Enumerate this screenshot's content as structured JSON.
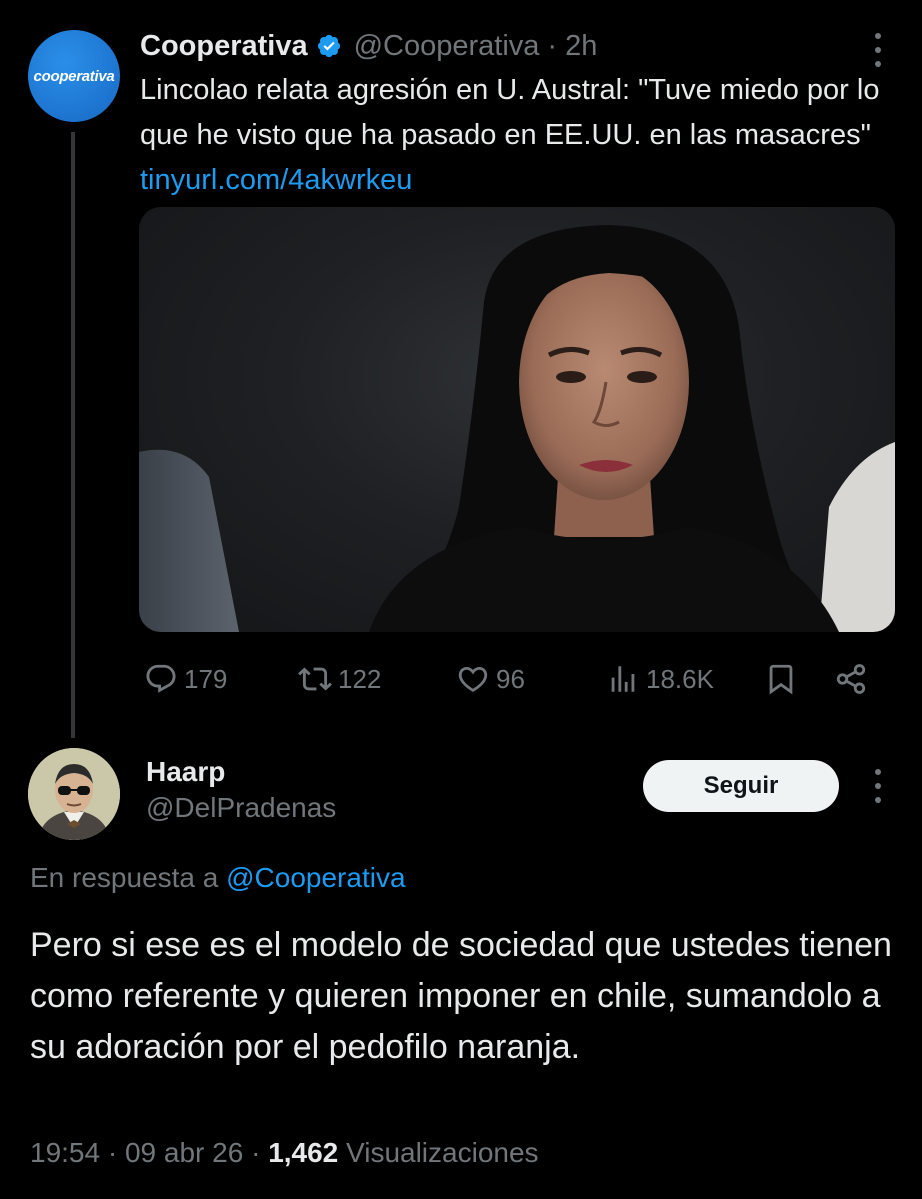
{
  "parent_tweet": {
    "author_name": "Cooperativa",
    "avatar_text": "cooperativa",
    "handle": "@Cooperativa",
    "separator": "·",
    "time": "2h",
    "text": "Lincolao relata agresión en U. Austral: \"Tuve miedo por lo que he visto que ha pasado en EE.UU. en las masacres\"",
    "link": "tinyurl.com/4akwrkeu",
    "actions": {
      "replies": "179",
      "reposts": "122",
      "likes": "96",
      "views": "18.6K"
    }
  },
  "reply": {
    "author_name": "Haarp",
    "handle": "@DelPradenas",
    "follow_label": "Seguir",
    "in_reply_prefix": "En respuesta a",
    "in_reply_mention": "@Cooperativa",
    "text": "Pero si ese es el modelo de sociedad que ustedes tienen como referente y quieren imponer en chile, sumandolo a su adoración por el pedofilo naranja.",
    "time": "19:54",
    "date": "09 abr 26",
    "separator": "·",
    "views_count": "1,462",
    "views_label": "Visualizaciones"
  },
  "colors": {
    "background": "#000000",
    "text_primary": "#e7e9ea",
    "text_secondary": "#71767b",
    "accent_link": "#1d9bf0",
    "brand_avatar": "#1d74cf"
  },
  "icons": [
    "verified-badge-icon",
    "more-icon",
    "reply-icon",
    "repost-icon",
    "like-icon",
    "views-icon",
    "bookmark-icon",
    "share-icon"
  ]
}
